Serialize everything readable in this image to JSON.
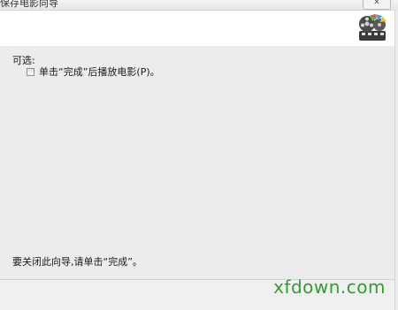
{
  "window": {
    "title": "保存电影向导",
    "close_glyph": "✕"
  },
  "header": {
    "logo_icon": "movie-maker-film-reel-icon"
  },
  "main": {
    "optional_label": "可选:",
    "checkbox_label": "单击“完成”后播放电影(P)。",
    "checkbox_checked": false,
    "finish_hint": "要关闭此向导,请单击“完成”。"
  },
  "watermark": {
    "text": "xfdown.com",
    "color": "#2f9e2f"
  }
}
